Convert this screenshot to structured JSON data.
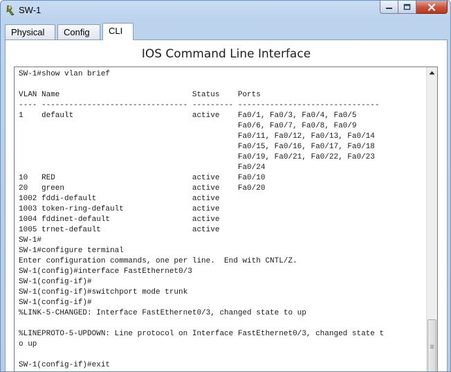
{
  "window": {
    "title": "SW-1",
    "icon": "switch-app-icon"
  },
  "tabs": [
    {
      "label": "Physical",
      "active": false
    },
    {
      "label": "Config",
      "active": false
    },
    {
      "label": "CLI",
      "active": true
    }
  ],
  "panel": {
    "heading": "IOS Command Line Interface"
  },
  "console": {
    "lines": [
      "SW-1#show vlan brief",
      "",
      "VLAN Name                             Status    Ports",
      "---- -------------------------------- --------- -------------------------------",
      "1    default                          active    Fa0/1, Fa0/3, Fa0/4, Fa0/5",
      "                                                Fa0/6, Fa0/7, Fa0/8, Fa0/9",
      "                                                Fa0/11, Fa0/12, Fa0/13, Fa0/14",
      "                                                Fa0/15, Fa0/16, Fa0/17, Fa0/18",
      "                                                Fa0/19, Fa0/21, Fa0/22, Fa0/23",
      "                                                Fa0/24",
      "10   RED                              active    Fa0/10",
      "20   green                            active    Fa0/20",
      "1002 fddi-default                     active",
      "1003 token-ring-default               active",
      "1004 fddinet-default                  active",
      "1005 trnet-default                    active",
      "SW-1#",
      "SW-1#configure terminal",
      "Enter configuration commands, one per line.  End with CNTL/Z.",
      "SW-1(config)#interface FastEthernet0/3",
      "SW-1(config-if)#",
      "SW-1(config-if)#switchport mode trunk",
      "SW-1(config-if)#",
      "%LINK-5-CHANGED: Interface FastEthernet0/3, changed state to up",
      "",
      "%LINEPROTO-5-UPDOWN: Line protocol on Interface FastEthernet0/3, changed state t",
      "o up",
      "",
      "SW-1(config-if)#exit"
    ]
  },
  "colors": {
    "close_button": "#c8523c",
    "window_frame": "#bcd3ee"
  }
}
